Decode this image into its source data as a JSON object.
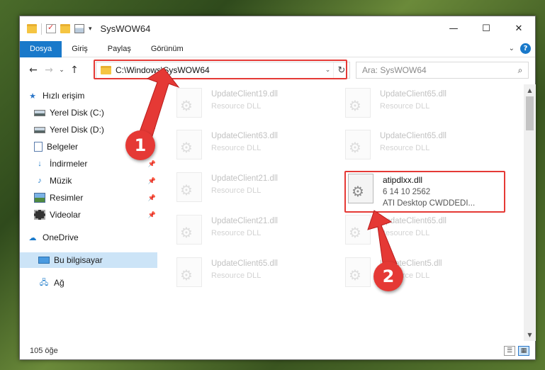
{
  "window": {
    "title": "SysWOW64",
    "controls": {
      "minimize": "—",
      "maximize": "☐",
      "close": "✕"
    }
  },
  "ribbon": {
    "tabs": [
      "Dosya",
      "Giriş",
      "Paylaş",
      "Görünüm"
    ],
    "active_tab": "Dosya",
    "expand_icon": "chevron-down-icon",
    "help_label": "?"
  },
  "navigation": {
    "back": "←",
    "forward": "→",
    "recent": "⌄",
    "up": "↑",
    "address": "C:\\Windows\\SysWOW64",
    "search_placeholder": "Ara: SysWOW64"
  },
  "sidebar": {
    "items": [
      {
        "label": "Hızlı erişim",
        "icon": "star-icon"
      },
      {
        "label": "Yerel Disk (C:)",
        "icon": "drive-icon",
        "pinned": true
      },
      {
        "label": "Yerel Disk (D:)",
        "icon": "drive-icon",
        "pinned": true
      },
      {
        "label": "Belgeler",
        "icon": "documents-icon",
        "pinned": true
      },
      {
        "label": "İndirmeler",
        "icon": "downloads-icon",
        "pinned": true
      },
      {
        "label": "Müzik",
        "icon": "music-icon",
        "pinned": true
      },
      {
        "label": "Resimler",
        "icon": "pictures-icon",
        "pinned": true
      },
      {
        "label": "Videolar",
        "icon": "videos-icon",
        "pinned": true
      },
      {
        "label": "OneDrive",
        "icon": "onedrive-icon"
      },
      {
        "label": "Bu bilgisayar",
        "icon": "this-pc-icon",
        "selected": true
      },
      {
        "label": "Ağ",
        "icon": "network-icon"
      }
    ]
  },
  "files": [
    {
      "name": "UpdateClient19.dll",
      "desc": "Resource DLL",
      "faded": true
    },
    {
      "name": "UpdateClient65.dll",
      "desc": "Resource DLL",
      "faded": true
    },
    {
      "name": "UpdateClient63.dll",
      "desc": "Resource DLL",
      "faded": true
    },
    {
      "name": "UpdateClient65.dll",
      "desc": "Resource DLL",
      "faded": true
    },
    {
      "name": "UpdateClient21.dll",
      "desc": "Resource DLL",
      "faded": true
    },
    {
      "name": "atipdlxx.dll",
      "desc": "6 14 10 2562",
      "desc2": "ATI Desktop CWDDEDI...",
      "faded": false
    },
    {
      "name": "UpdateClient21.dll",
      "desc": "Resource DLL",
      "faded": true
    },
    {
      "name": "UpdateClient65.dll",
      "desc": "Resource DLL",
      "faded": true
    },
    {
      "name": "UpdateClient65.dll",
      "desc": "Resource DLL",
      "faded": true
    },
    {
      "name": "UpdateClient5.dll",
      "desc": "Resource DLL",
      "faded": true
    }
  ],
  "status": {
    "item_count": "105 öğe"
  },
  "annotations": {
    "step1": "1",
    "step2": "2",
    "highlight_color": "#e53935"
  },
  "colors": {
    "accent": "#1979ca",
    "selection": "#cce4f7"
  }
}
